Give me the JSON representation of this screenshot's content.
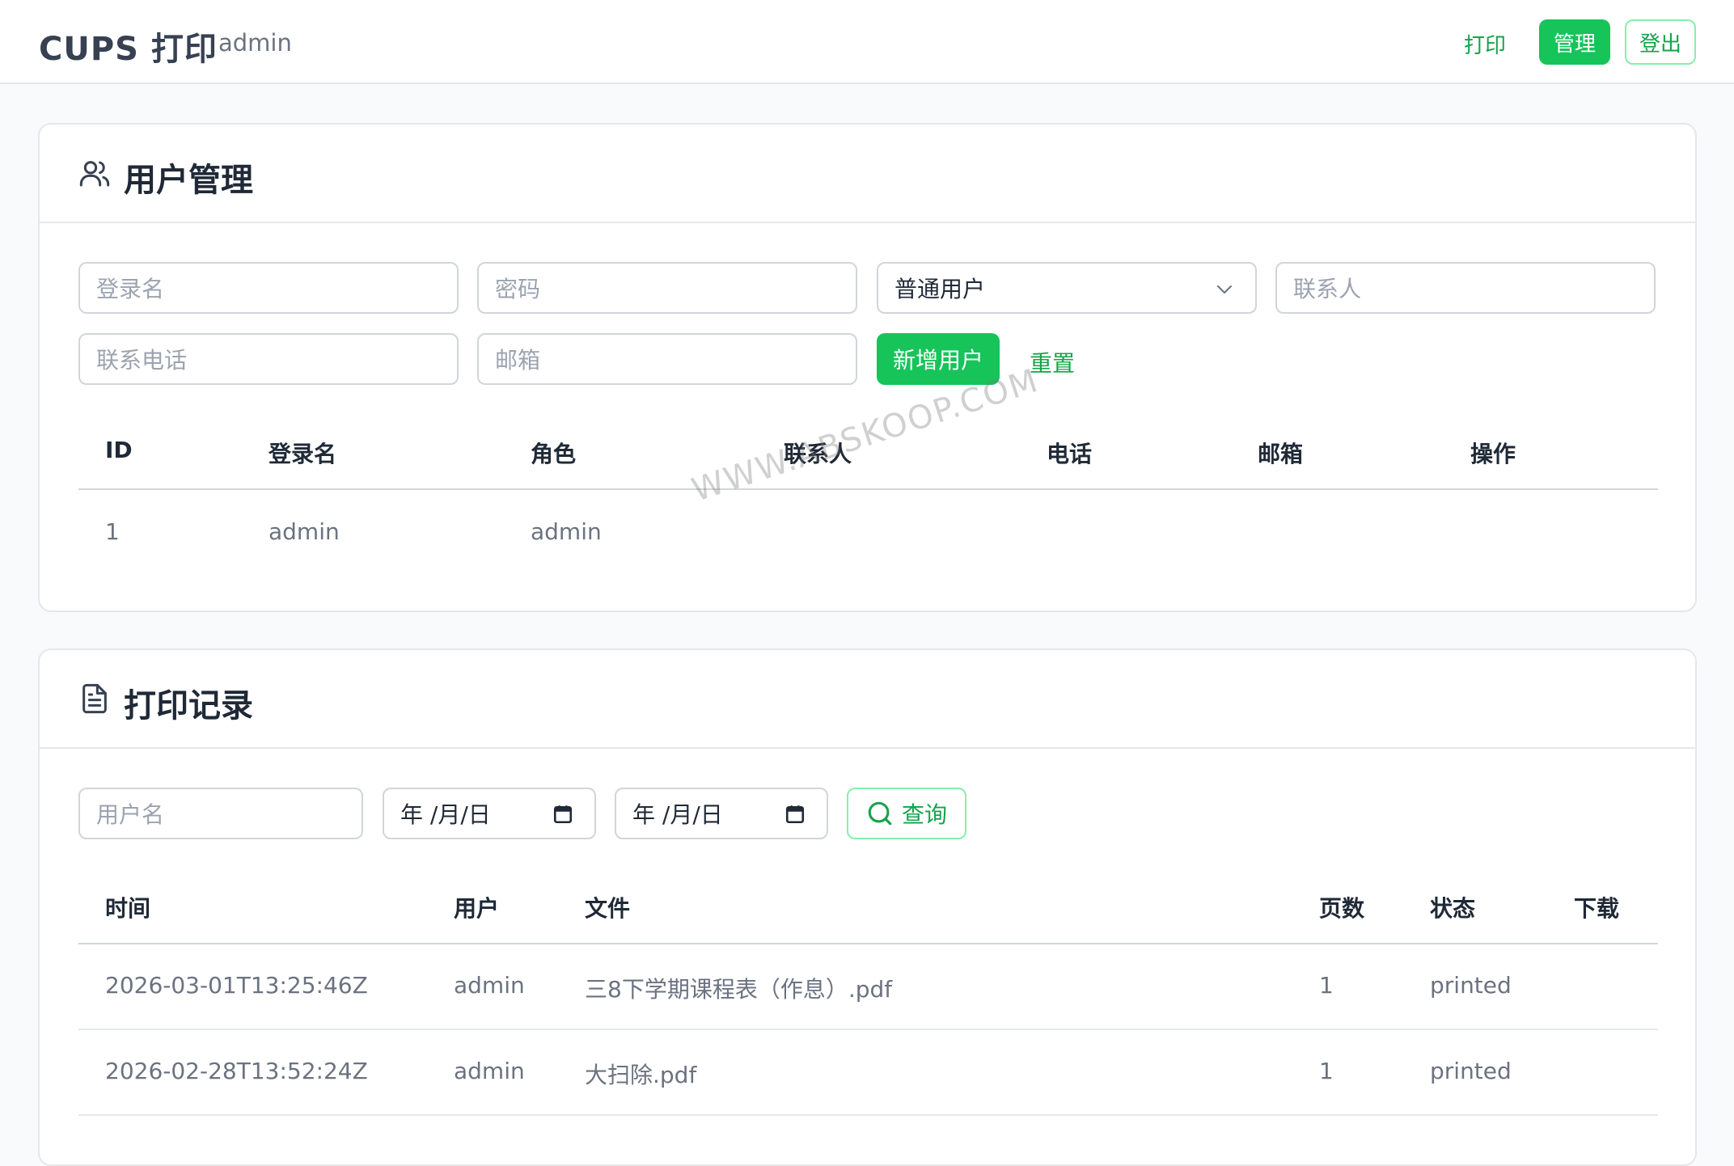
{
  "header": {
    "brand": "CUPS 打印",
    "user": "admin",
    "nav": {
      "print": "打印",
      "manage": "管理",
      "logout": "登出"
    }
  },
  "users_section": {
    "title": "用户管理",
    "form": {
      "login_placeholder": "登录名",
      "password_placeholder": "密码",
      "role_selected": "普通用户",
      "contact_placeholder": "联系人",
      "phone_placeholder": "联系电话",
      "email_placeholder": "邮箱",
      "add_button": "新增用户",
      "reset_button": "重置"
    },
    "table": {
      "headers": [
        "ID",
        "登录名",
        "角色",
        "联系人",
        "电话",
        "邮箱",
        "操作"
      ],
      "rows": [
        {
          "id": "1",
          "login": "admin",
          "role": "admin",
          "contact": "",
          "phone": "",
          "email": "",
          "actions": ""
        }
      ]
    }
  },
  "records_section": {
    "title": "打印记录",
    "filter": {
      "username_placeholder": "用户名",
      "date_from": "年 /月/日",
      "date_to": "年 /月/日",
      "query_button": "查询"
    },
    "table": {
      "headers": [
        "时间",
        "用户",
        "文件",
        "页数",
        "状态",
        "下载"
      ],
      "rows": [
        {
          "time": "2026-03-01T13:25:46Z",
          "user": "admin",
          "file": "三8下学期课程表（作息）.pdf",
          "pages": "1",
          "status": "printed",
          "download": ""
        },
        {
          "time": "2026-02-28T13:52:24Z",
          "user": "admin",
          "file": "大扫除.pdf",
          "pages": "1",
          "status": "printed",
          "download": ""
        }
      ]
    }
  },
  "watermark": "WWW.ABSKOOP.COM",
  "colors": {
    "accent": "#16c45a",
    "accent_text": "#16a34a",
    "border": "#e5e7eb"
  },
  "icons": {
    "users": "users-icon",
    "records": "document-icon",
    "select": "chevron-down-icon",
    "date": "calendar-icon",
    "query": "search-icon"
  }
}
